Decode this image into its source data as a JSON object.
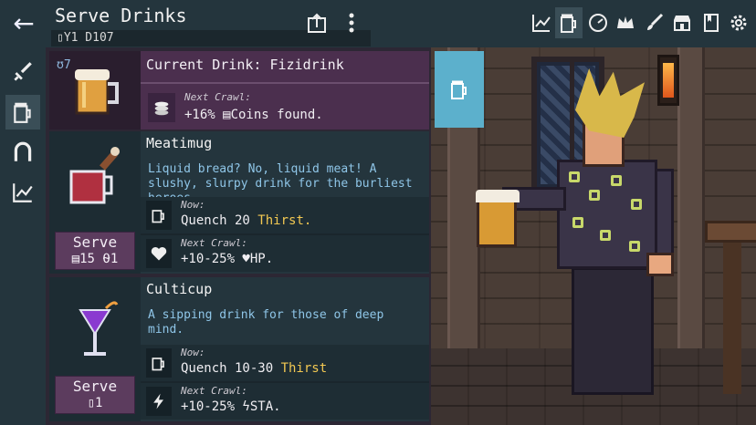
{
  "header": {
    "title": "Serve Drinks",
    "date": "Y1 D107",
    "back_icon": "arrow-left-icon",
    "icons": [
      "share-icon",
      "more-vert-icon",
      "chart-icon",
      "mug-icon",
      "gauge-icon",
      "crown-icon",
      "brush-icon",
      "shop-icon",
      "book-icon",
      "gear-icon"
    ]
  },
  "rail": {
    "items": [
      "sword-icon",
      "mug-icon",
      "magnet-icon",
      "chart-icon"
    ]
  },
  "current_drink": {
    "name": "Current Drink: Fizidrink",
    "count": "ʊ7",
    "next_crawl_label": "Next Crawl:",
    "bonus": "+16% ▤Coins found."
  },
  "drinks": [
    {
      "name": "Meatimug",
      "description": "Liquid bread?  No, liquid meat!  A slushy, slurpy drink for the burliest heroes.",
      "now_label": "Now:",
      "quench": "Quench 20 ",
      "quench_stat": "Thirst.",
      "next_label": "Next Crawl:",
      "bonus": "+10-25% ♥HP.",
      "serve_label": "Serve",
      "serve_cost": "▤15 ⍬1"
    },
    {
      "name": "Culticup",
      "description": "A sipping drink for those of deep mind.",
      "now_label": "Now:",
      "quench": "Quench 10-30 ",
      "quench_stat": "Thirst",
      "next_label": "Next Crawl:",
      "bonus": "+10-25% ϟSTA.",
      "serve_label": "Serve",
      "serve_cost": "▯1"
    }
  ],
  "colors": {
    "accent": "#5cb0cc",
    "gold": "#f2c852",
    "desc": "#8fc6e8",
    "serve": "#5c3c5e"
  }
}
